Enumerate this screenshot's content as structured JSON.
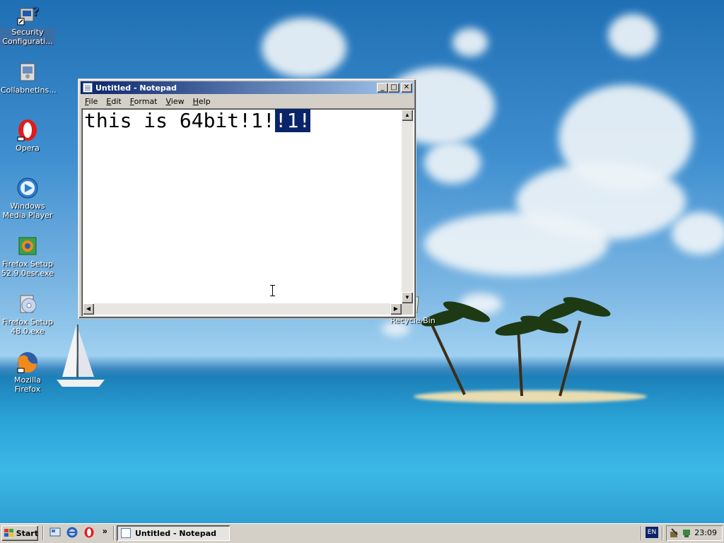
{
  "desktop": {
    "icons": [
      {
        "label": "Security Configurati...",
        "icon": "security-config-icon"
      },
      {
        "label": "CollabnetIns...",
        "icon": "installer-icon"
      },
      {
        "label": "Opera",
        "icon": "opera-icon"
      },
      {
        "label": "Windows Media Player",
        "icon": "media-player-icon"
      },
      {
        "label": "Firefox Setup 52.9.0esr.exe",
        "icon": "firefox-setup-icon"
      },
      {
        "label": "Firefox Setup 48.0.exe",
        "icon": "setup-cd-icon"
      },
      {
        "label": "Mozilla Firefox",
        "icon": "firefox-icon"
      },
      {
        "label": "Recycle Bin",
        "icon": "recycle-bin-icon"
      }
    ]
  },
  "notepad": {
    "title": "Untitled - Notepad",
    "buttons": {
      "minimize": "_",
      "maximize": "□",
      "close": "✕"
    },
    "menu": [
      {
        "underline": "F",
        "rest": "ile"
      },
      {
        "underline": "E",
        "rest": "dit"
      },
      {
        "underline": "F",
        "rest": "ormat"
      },
      {
        "underline": "V",
        "rest": "iew"
      },
      {
        "underline": "H",
        "rest": "elp"
      }
    ],
    "text_plain": "this is 64bit!1!",
    "text_selected": "!1!"
  },
  "taskbar": {
    "start_label": "Start",
    "quicklaunch": [
      "show-desktop-icon",
      "internet-explorer-icon",
      "opera-icon"
    ],
    "overflow": "»",
    "task_label": "Untitled - Notepad",
    "language": "EN",
    "clock": "23:09"
  },
  "colors": {
    "titlebar_start": "#0a246a",
    "titlebar_end": "#a6caf0",
    "selection": "#0a246a",
    "face": "#d4d0c8"
  }
}
